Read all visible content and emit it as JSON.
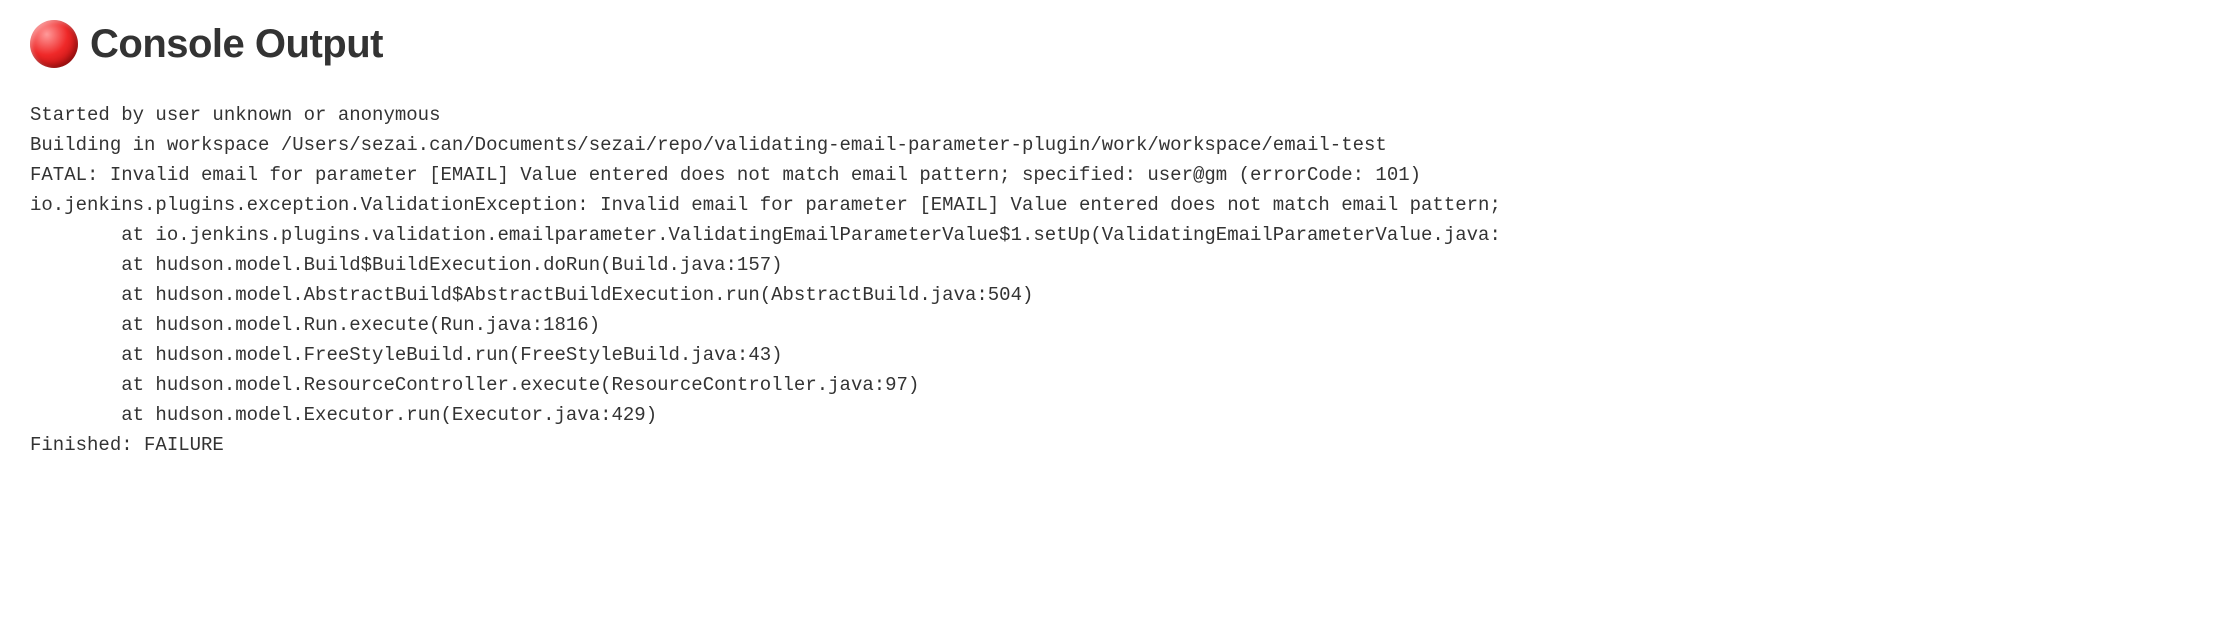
{
  "header": {
    "title": "Console Output",
    "status": "failure"
  },
  "console": {
    "lines": [
      "Started by user unknown or anonymous",
      "Building in workspace /Users/sezai.can/Documents/sezai/repo/validating-email-parameter-plugin/work/workspace/email-test",
      "FATAL: Invalid email for parameter [EMAIL] Value entered does not match email pattern; specified: user@gm (errorCode: 101)",
      "io.jenkins.plugins.exception.ValidationException: Invalid email for parameter [EMAIL] Value entered does not match email pattern;",
      "\tat io.jenkins.plugins.validation.emailparameter.ValidatingEmailParameterValue$1.setUp(ValidatingEmailParameterValue.java:",
      "\tat hudson.model.Build$BuildExecution.doRun(Build.java:157)",
      "\tat hudson.model.AbstractBuild$AbstractBuildExecution.run(AbstractBuild.java:504)",
      "\tat hudson.model.Run.execute(Run.java:1816)",
      "\tat hudson.model.FreeStyleBuild.run(FreeStyleBuild.java:43)",
      "\tat hudson.model.ResourceController.execute(ResourceController.java:97)",
      "\tat hudson.model.Executor.run(Executor.java:429)",
      "Finished: FAILURE"
    ]
  }
}
